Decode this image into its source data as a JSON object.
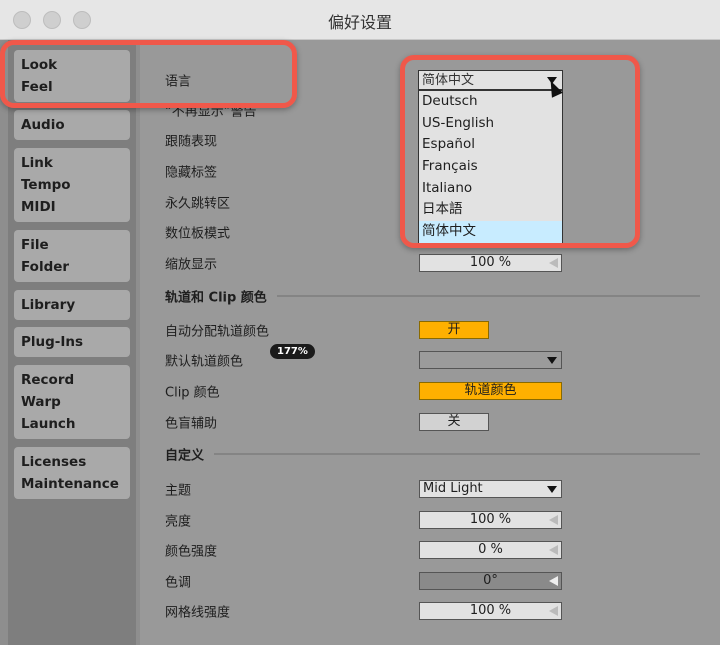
{
  "window": {
    "title": "偏好设置"
  },
  "sidebar": {
    "items": [
      {
        "lines": [
          "Look",
          "Feel"
        ]
      },
      {
        "lines": [
          "Audio"
        ]
      },
      {
        "lines": [
          "Link",
          "Tempo",
          "MIDI"
        ]
      },
      {
        "lines": [
          "File",
          "Folder"
        ]
      },
      {
        "lines": [
          "Library"
        ]
      },
      {
        "lines": [
          "Plug-Ins"
        ]
      },
      {
        "lines": [
          "Record",
          "Warp",
          "Launch"
        ]
      },
      {
        "lines": [
          "Licenses",
          "Maintenance"
        ]
      }
    ],
    "selected": "Look Feel"
  },
  "main": {
    "language_label": "语言",
    "language_value": "简体中文",
    "language_options": [
      "Deutsch",
      "US-English",
      "Español",
      "Français",
      "Italiano",
      "日本語",
      "简体中文"
    ],
    "rows_general": [
      "“不再显示”警告",
      "跟随表现",
      "隐藏标签",
      "永久跳转区",
      "数位板模式",
      "缩放显示"
    ],
    "zoom_value": "100 %",
    "section_track": "轨道和 Clip 颜色",
    "auto_color_label": "自动分配轨道颜色",
    "auto_color_value": "开",
    "default_color_label": "默认轨道颜色",
    "clip_color_label": "Clip 颜色",
    "clip_color_value": "轨道颜色",
    "colorblind_label": "色盲辅助",
    "colorblind_value": "关",
    "section_custom": "自定义",
    "theme_label": "主题",
    "theme_value": "Mid Light",
    "brightness_label": "亮度",
    "brightness_value": "100 %",
    "saturation_label": "颜色强度",
    "saturation_value": "0 %",
    "hue_label": "色调",
    "hue_value": "0°",
    "grid_label": "网格线强度",
    "grid_value": "100 %"
  },
  "zoom_badge": "177%",
  "colors": {
    "accent_orange": "#ffb000",
    "highlight_red": "#f0584a",
    "selected_option": "#c8ecff"
  }
}
